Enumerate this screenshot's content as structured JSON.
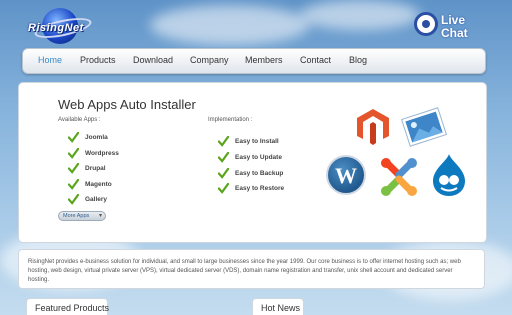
{
  "header": {
    "logo_text": "RisingNet",
    "livechat": {
      "line1": "Live",
      "line2": "Chat"
    }
  },
  "nav": {
    "items": [
      "Home",
      "Products",
      "Download",
      "Company",
      "Members",
      "Contact",
      "Blog"
    ],
    "active": "Home",
    "active_color": "#3a8bc8"
  },
  "installer": {
    "title": "Web Apps Auto Installer",
    "available_heading": "Available Apps :",
    "available_apps": [
      "Joomla",
      "Wordpress",
      "Drupal",
      "Magento",
      "Gallery"
    ],
    "implementation_heading": "Implementation :",
    "implementation": [
      "Easy to Install",
      "Easy to Update",
      "Easy to Backup",
      "Easy to Restore"
    ],
    "more_button": "More Apps",
    "app_icons": [
      "magento-logo",
      "gallery-photos-logo",
      "wordpress-logo",
      "joomla-logo",
      "drupal-logo"
    ],
    "check_color": "#5aa51d"
  },
  "description": "RisingNet provides e-business solution for individual, and small to large businesses since the year 1999. Our core business is to offer internet hosting such as; web hosting, web design, virtual private server (VPS), virtual dedicated server (VDS), domain name registration and transfer, unix shell account and dedicated server hosting.",
  "tabs": {
    "featured": "Featured Products",
    "hotnews": "Hot News"
  }
}
